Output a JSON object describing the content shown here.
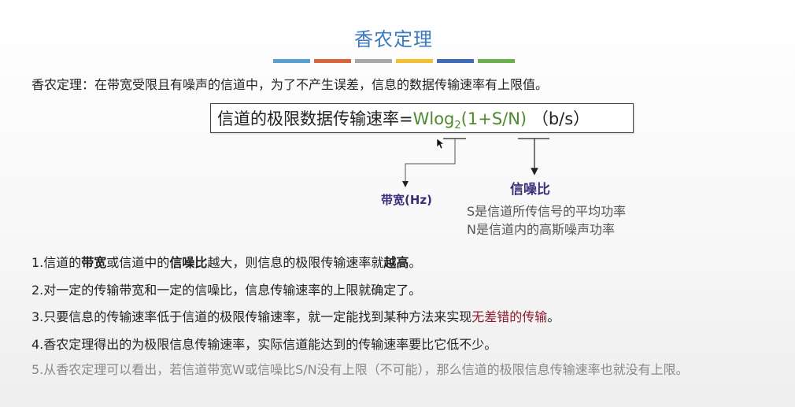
{
  "title": "香农定理",
  "color_bar": [
    "#5a9fd4",
    "#d9643a",
    "#a8a8a8",
    "#f2c02e",
    "#3f6bb8",
    "#6ab04c"
  ],
  "intro": "香农定理：在带宽受限且有噪声的信道中，为了不产生误差，信息的数据传输速率有上限值。",
  "formula": {
    "prefix": "信道的极限数据传输速率=",
    "w_log": "Wlog",
    "sub": "2",
    "arg": "(1+S/N)",
    "unit": "（b/s）"
  },
  "labels": {
    "bandwidth": "带宽(Hz)",
    "snr": "信噪比",
    "s_def": "S是信道所传信号的平均功率",
    "n_def": "N是信道内的高斯噪声功率"
  },
  "items": {
    "i1": {
      "a": "1.信道的",
      "b": "带宽",
      "c": "或信道中的",
      "d": "信噪比",
      "e": "越大，则信息的极限传输速率就",
      "f": "越高",
      "g": "。"
    },
    "i2": "2.对一定的传输带宽和一定的信噪比，信息传输速率的上限就确定了。",
    "i3": {
      "a": "3.只要信息的传输速率低于信道的极限传输速率，就一定能找到某种方法来实现",
      "b": "无差错的传输",
      "c": "。"
    },
    "i4": "4.香农定理得出的为极限信息传输速率，实际信道能达到的传输速率要比它低不少。",
    "i5": "5.从香农定理可以看出，若信道带宽W或信噪比S/N没有上限（不可能），那么信道的极限信息传输速率也就没有上限。"
  }
}
